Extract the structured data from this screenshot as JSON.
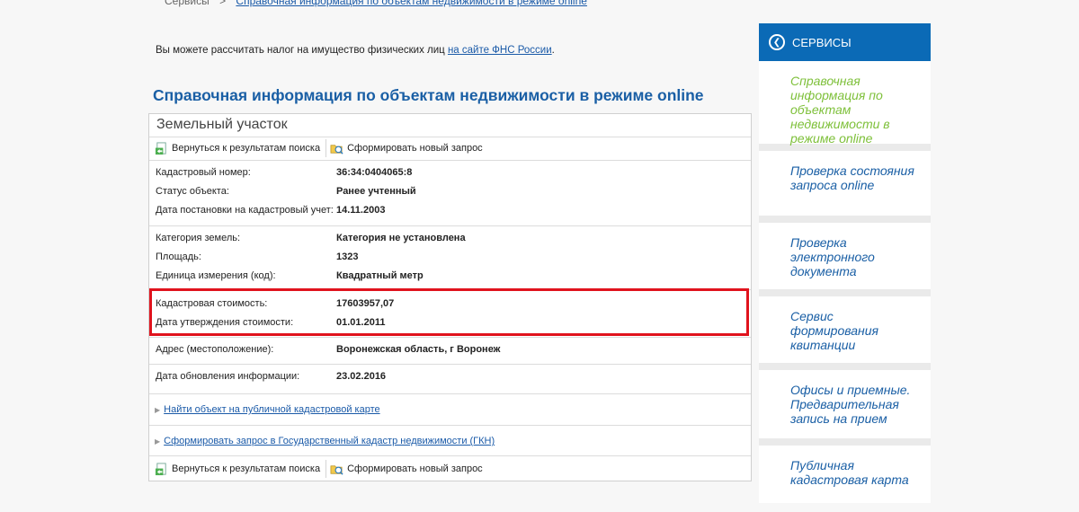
{
  "breadcrumb": {
    "root": "Сервисы",
    "current": "Справочная информация по объектам недвижимости в режиме online"
  },
  "intro": {
    "text": "Вы можете рассчитать налог на имущество физических лиц ",
    "link": "на сайте ФНС России",
    "suffix": "."
  },
  "page_title": "Справочная информация по объектам недвижимости в режиме online",
  "card": {
    "title": "Земельный участок",
    "toolbar": {
      "back_label": "Вернуться к результатам поиска",
      "new_request_label": "Сформировать новый запрос"
    },
    "groups": [
      [
        {
          "label": "Кадастровый номер:",
          "value": "36:34:0404065:8"
        },
        {
          "label": "Статус объекта:",
          "value": "Ранее учтенный"
        },
        {
          "label": "Дата постановки на кадастровый учет:",
          "value": "14.11.2003"
        }
      ],
      [
        {
          "label": "Категория земель:",
          "value": "Категория не установлена"
        },
        {
          "label": "Площадь:",
          "value": "1323"
        },
        {
          "label": "Единица измерения (код):",
          "value": "Квадратный метр"
        }
      ],
      [
        {
          "label": "Кадастровая стоимость:",
          "value": "17603957,07"
        },
        {
          "label": "Дата утверждения стоимости:",
          "value": "01.01.2011"
        }
      ],
      [
        {
          "label": "Адрес (местоположение):",
          "value": "Воронежская область, г Воронеж"
        }
      ],
      [
        {
          "label": "Дата обновления информации:",
          "value": "23.02.2016"
        }
      ]
    ],
    "links": {
      "map": "Найти объект на публичной кадастровой карте",
      "gkn": "Сформировать запрос в Государственный кадастр недвижимости (ГКН)"
    }
  },
  "sidebar": {
    "header": "СЕРВИСЫ",
    "items": [
      "Справочная информация по объектам недвижимости в режиме online",
      "Проверка состояния запроса online",
      "Проверка электронного документа",
      "Сервис формирования квитанции",
      "Офисы и приемные. Предварительная запись на прием",
      "Публичная кадастровая карта"
    ]
  },
  "colors": {
    "accent_blue": "#0b6ab6",
    "title_blue": "#1a5fa5",
    "active_green": "#7ec03a",
    "highlight_red": "#e0131d"
  }
}
